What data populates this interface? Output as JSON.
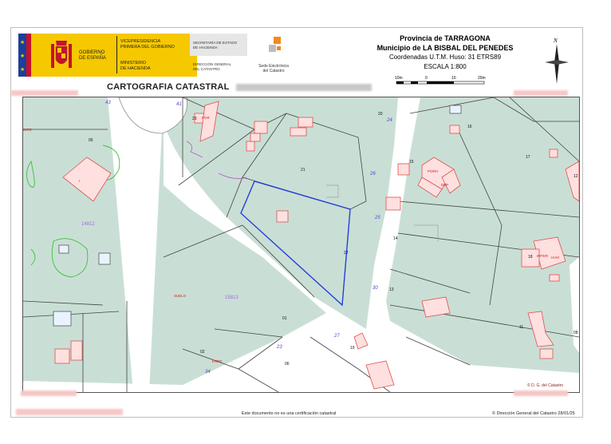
{
  "header": {
    "gobierno": [
      "GOBIERNO",
      "DE ESPAÑA"
    ],
    "vicepresidencia": [
      "VICEPRESIDENCIA",
      "PRIMERA DEL GOBIERNO"
    ],
    "ministerio": [
      "MINISTERIO",
      "DE HACIENDA"
    ],
    "secretaria": [
      "SECRETARÍA DE ESTADO",
      "DE HACIENDA"
    ],
    "direccion": [
      "DIRECCIÓN GENERAL",
      "DEL CATASTRO"
    ],
    "sede": [
      "Sede Electrónica",
      "del Catastro"
    ],
    "cartografia": "CARTOGRAFIA CATASTRAL"
  },
  "info": {
    "provincia": "Provincia de TARRAGONA",
    "municipio": "Municipio de LA BISBAL DEL PENEDES",
    "coordenadas": "Coordenadas U.T.M. Huso: 31 ETRS89",
    "escala": "ESCALA 1:800",
    "scale_ticks": [
      "10m",
      "0",
      "10",
      "20m"
    ],
    "north": "N"
  },
  "map": {
    "blocks": [
      "14812",
      "15813"
    ],
    "parcels": [
      "05",
      "23",
      "21",
      "22",
      "20",
      "15",
      "16",
      "14",
      "13",
      "17",
      "01",
      "02",
      "06",
      "11",
      "19",
      "18",
      "12",
      "08"
    ],
    "streets": [
      "43",
      "41",
      "26",
      "25",
      "24",
      "23",
      "30",
      "27",
      "34"
    ],
    "buildings_codes": [
      "PGR",
      "I",
      "DEP",
      "PORH",
      "DIRE",
      "SUELO",
      "ERRE",
      "IMTER",
      "HAVI"
    ],
    "copyright": "© D. G. del Catastro"
  },
  "footer": {
    "notice": "Este documento no es una certificación catastral",
    "credit": "© Dirección General del Catastro 28/01/25"
  },
  "colors": {
    "parcel_fill": "#c9dfd5",
    "building_fill": "#fde0df",
    "building_stroke": "#e05050",
    "highlight": "#2340d8",
    "block_label": "#9a6ee0",
    "street_label": "#5a3fd0"
  }
}
